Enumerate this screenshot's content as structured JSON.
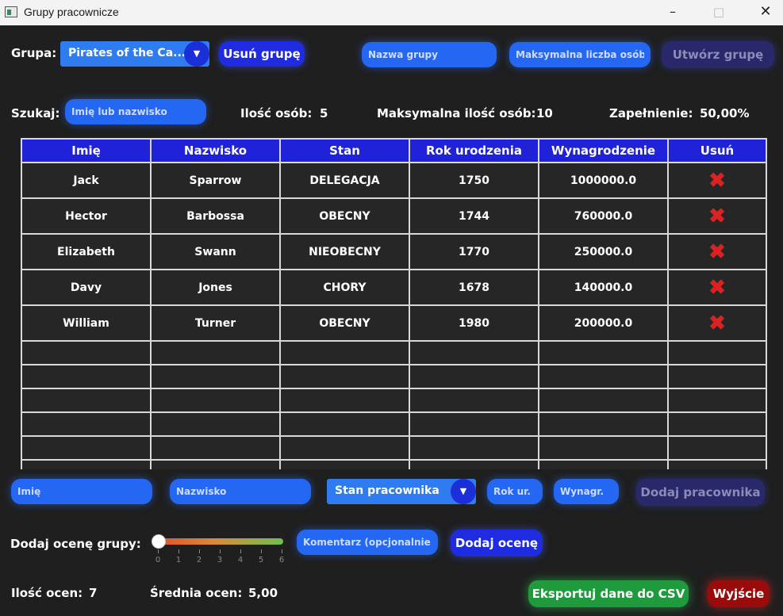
{
  "window": {
    "title": "Grupy pracownicze",
    "minimize_icon": "minimize-icon",
    "maximize_icon": "maximize-icon",
    "close_icon": "close-icon"
  },
  "group_bar": {
    "group_label": "Grupa:",
    "group_selected": "Pirates of the Ca...",
    "delete_group_button": "Usuń grupę",
    "group_name_placeholder": "Nazwa grupy",
    "max_people_placeholder": "Maksymalna liczba osób",
    "create_group_button": "Utwórz grupę"
  },
  "stats_bar": {
    "search_label": "Szukaj:",
    "search_placeholder": "Imię lub nazwisko",
    "count_label": "Ilość osób:",
    "count_value": "5",
    "max_label": "Maksymalna ilość osób:",
    "max_value": "10",
    "fill_label": "Zapełnienie:",
    "fill_value": "50,00%"
  },
  "table": {
    "columns": [
      "Imię",
      "Nazwisko",
      "Stan",
      "Rok urodzenia",
      "Wynagrodzenie",
      "Usuń"
    ],
    "rows": [
      {
        "first": "Jack",
        "last": "Sparrow",
        "state": "DELEGACJA",
        "year": "1750",
        "salary": "1000000.0"
      },
      {
        "first": "Hector",
        "last": "Barbossa",
        "state": "OBECNY",
        "year": "1744",
        "salary": "760000.0"
      },
      {
        "first": "Elizabeth",
        "last": "Swann",
        "state": "NIEOBECNY",
        "year": "1770",
        "salary": "250000.0"
      },
      {
        "first": "Davy",
        "last": "Jones",
        "state": "CHORY",
        "year": "1678",
        "salary": "140000.0"
      },
      {
        "first": "William",
        "last": "Turner",
        "state": "OBECNY",
        "year": "1980",
        "salary": "200000.0"
      }
    ],
    "delete_icon": "delete-x-icon"
  },
  "add_employee": {
    "first_placeholder": "Imię",
    "last_placeholder": "Nazwisko",
    "state_selected": "Stan pracownika",
    "year_placeholder": "Rok ur.",
    "salary_placeholder": "Wynagr.",
    "add_button": "Dodaj pracownika"
  },
  "rating": {
    "label": "Dodaj ocenę grupy:",
    "slider_value": 0,
    "slider_ticks": [
      "0",
      "1",
      "2",
      "3",
      "4",
      "5",
      "6"
    ],
    "comment_placeholder": "Komentarz (opcjonalnie)",
    "add_button": "Dodaj ocenę"
  },
  "footer": {
    "count_label": "Ilość ocen:",
    "count_value": "7",
    "avg_label": "Średnia ocen:",
    "avg_value": "5,00",
    "export_button": "Eksportuj dane do CSV",
    "exit_button": "Wyjście"
  },
  "colors": {
    "background": "#1f1f1f",
    "accent_blue": "#1f2be0",
    "field_blue": "#2367f2",
    "header_blue": "#1f22d8",
    "delete_red": "#e02020",
    "export_green": "#1f9a3c",
    "exit_red": "#9a0b0b"
  }
}
